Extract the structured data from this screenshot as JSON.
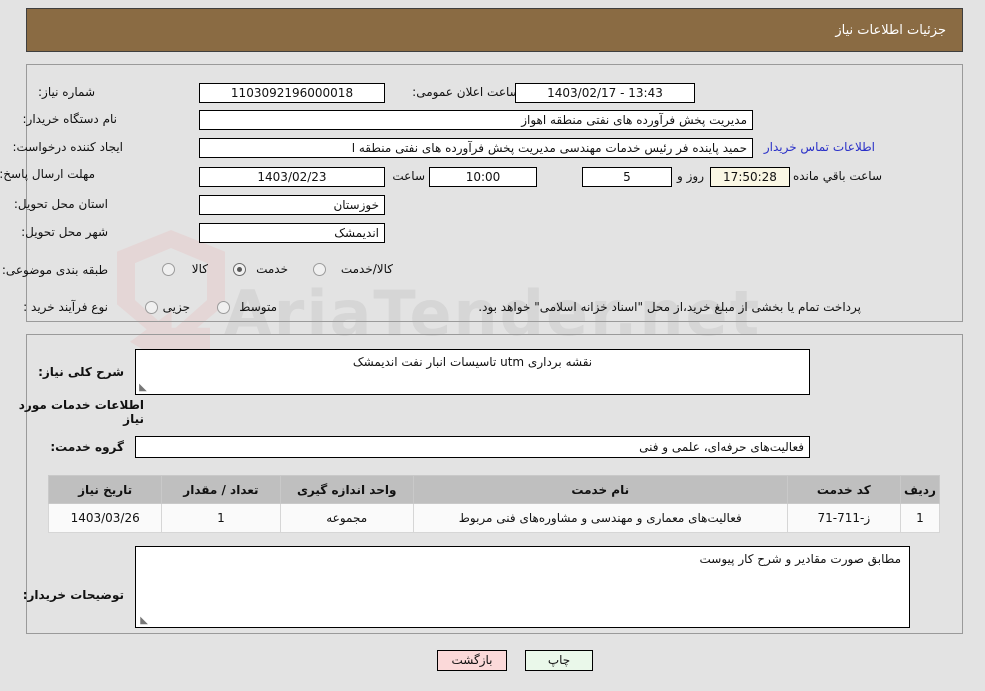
{
  "header": {
    "title": "جزئیات اطلاعات نیاز"
  },
  "watermark": {
    "text": "AriaTender.net"
  },
  "top_section": {
    "need_number_label": "شماره نیاز:",
    "need_number_value": "1103092196000018",
    "announce_datetime_label": "تاریخ و ساعت اعلان عمومی:",
    "announce_datetime_value": "13:43 - 1403/02/17",
    "buyer_org_label": "نام دستگاه خریدار:",
    "buyer_org_value": "مدیریت پخش فرآورده های نفتی منطقه اهواز",
    "requester_label": "ایجاد کننده درخواست:",
    "requester_value": "حمید پاینده فر رئیس خدمات مهندسی مدیریت پخش فرآورده های نفتی منطقه ا",
    "contact_link": "اطلاعات تماس خریدار",
    "deadline_label": "مهلت ارسال پاسخ: تا تاریخ:",
    "deadline_date": "1403/02/23",
    "hour_label": "ساعت",
    "hour_value": "10:00",
    "days_value": "5",
    "days_label": "روز و",
    "countdown_value": "17:50:28",
    "countdown_label": "ساعت باقي مانده",
    "province_label": "استان محل تحویل:",
    "province_value": "خوزستان",
    "city_label": "شهر محل تحویل:",
    "city_value": "اندیمشک",
    "category_label": "طبقه بندی موضوعی:",
    "category_options": [
      {
        "label": "کالا",
        "selected": false
      },
      {
        "label": "خدمت",
        "selected": true
      },
      {
        "label": "کالا/خدمت",
        "selected": false
      }
    ],
    "process_label": "نوع فرآیند خرید :",
    "process_options": [
      {
        "label": "جزیی",
        "selected": false
      },
      {
        "label": "متوسط",
        "selected": false
      }
    ],
    "process_note": "پرداخت تمام یا بخشی از مبلغ خرید،از محل \"اسناد خزانه اسلامی\" خواهد بود."
  },
  "bottom_section": {
    "general_desc_label": "شرح کلی نیاز:",
    "general_desc_value": "نقشه برداری  utm   تاسیسات انبار نفت اندیمشک",
    "services_heading": "اطلاعات خدمات مورد نیاز",
    "service_group_label": "گروه خدمت:",
    "service_group_value": "فعالیت‌های حرفه‌ای، علمی و فنی",
    "buyer_notes_label": "توضیحات خریدار:",
    "buyer_notes_value": "مطابق صورت مقادیر و شرح کار پیوست"
  },
  "table": {
    "columns": [
      "ردیف",
      "کد خدمت",
      "نام خدمت",
      "واحد اندازه گیری",
      "تعداد / مقدار",
      "تاریخ نیاز"
    ],
    "rows": [
      {
        "row": "1",
        "code": "ز-711-71",
        "name": "فعالیت‌های معماری و مهندسی و مشاوره‌های فنی مربوط",
        "unit": "مجموعه",
        "qty": "1",
        "date": "1403/03/26"
      }
    ]
  },
  "buttons": {
    "print": "چاپ",
    "back": "بازگشت"
  },
  "colors": {
    "header_bg": "#8a6b43",
    "page_bg": "#e3e3e3",
    "link": "#2a30c8",
    "countdown_bg": "#faf7e4",
    "print_bg": "#eaf8ea",
    "back_bg": "#fbd9d9",
    "table_header_bg": "#bfbfbf"
  }
}
